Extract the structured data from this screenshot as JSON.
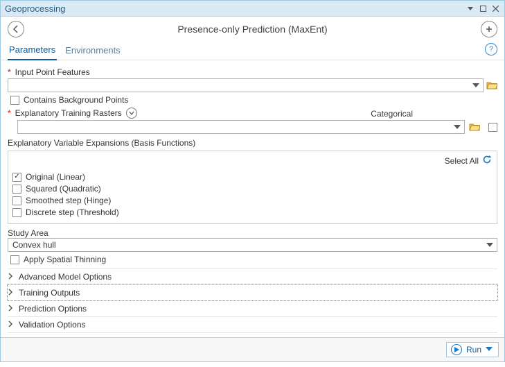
{
  "window": {
    "title": "Geoprocessing"
  },
  "tool": {
    "name": "Presence-only Prediction (MaxEnt)"
  },
  "tabs": {
    "parameters": "Parameters",
    "environments": "Environments"
  },
  "fields": {
    "inputPointFeatures": {
      "label": "Input Point Features",
      "value": ""
    },
    "containsBackground": {
      "label": "Contains Background Points",
      "checked": false
    },
    "explanatoryRasters": {
      "label": "Explanatory Training Rasters",
      "value": "",
      "categoricalLabel": "Categorical",
      "categoricalChecked": false
    },
    "basisFunctions": {
      "label": "Explanatory Variable Expansions (Basis Functions)",
      "selectAll": "Select All",
      "items": [
        {
          "label": "Original (Linear)",
          "checked": true
        },
        {
          "label": "Squared (Quadratic)",
          "checked": false
        },
        {
          "label": "Smoothed step (Hinge)",
          "checked": false
        },
        {
          "label": "Discrete step (Threshold)",
          "checked": false
        }
      ]
    },
    "studyArea": {
      "label": "Study Area",
      "value": "Convex hull"
    },
    "applyThinning": {
      "label": "Apply Spatial Thinning",
      "checked": false
    }
  },
  "accordion": {
    "items": [
      {
        "label": "Advanced Model Options"
      },
      {
        "label": "Training Outputs"
      },
      {
        "label": "Prediction Options"
      },
      {
        "label": "Validation Options"
      }
    ],
    "selectedIndex": 1
  },
  "footer": {
    "run": "Run"
  },
  "help": {
    "glyph": "?"
  }
}
